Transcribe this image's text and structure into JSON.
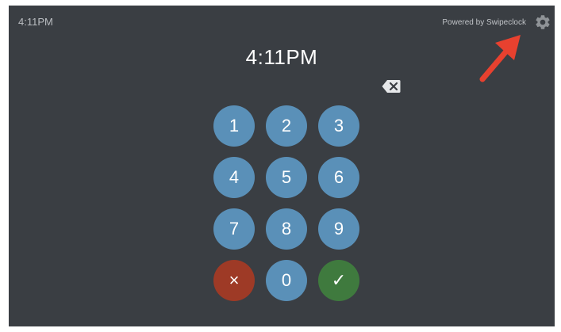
{
  "status_bar": {
    "time": "4:11PM",
    "powered_by": "Powered by Swipeclock"
  },
  "display": {
    "time": "4:11PM"
  },
  "keypad": {
    "keys": [
      "1",
      "2",
      "3",
      "4",
      "5",
      "6",
      "7",
      "8",
      "9",
      "×",
      "0",
      "✓"
    ]
  },
  "icons": {
    "settings": "gear-icon",
    "backspace": "backspace-icon",
    "annotation": "red-arrow-icon"
  },
  "colors": {
    "background": "#3a3e43",
    "key": "#5a90b8",
    "cancel": "#9e3a26",
    "confirm": "#3f7a3e",
    "arrow": "#e8412f"
  }
}
